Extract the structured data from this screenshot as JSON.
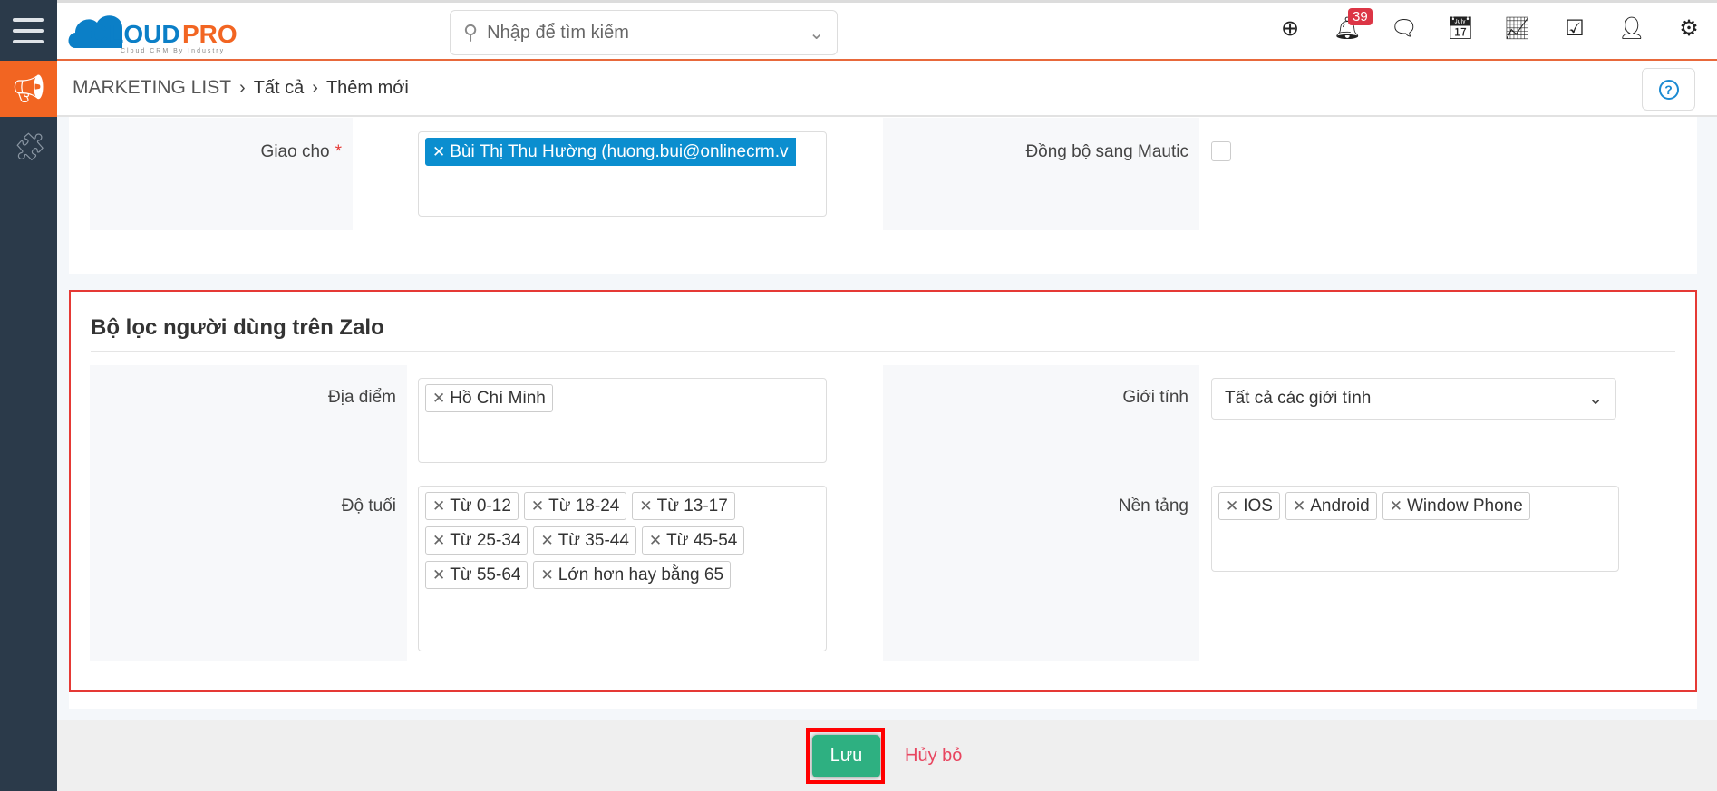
{
  "header": {
    "logo_text": "CLOUDPRO",
    "logo_tagline": "Cloud CRM By Industry",
    "search_placeholder": "Nhập để tìm kiếm",
    "notification_count": "39",
    "icons": [
      "plus-circle-icon",
      "bell-icon",
      "chat-icon",
      "calendar-icon",
      "chart-icon",
      "checkbox-icon",
      "user-icon",
      "gear-icon"
    ]
  },
  "breadcrumb": {
    "module": "MARKETING LIST",
    "items": [
      "Tất cả",
      "Thêm mới"
    ]
  },
  "assign": {
    "label": "Giao cho",
    "required": "*",
    "value": "Bùi Thị Thu Hường (huong.bui@onlinecrm.v",
    "sync_label": "Đồng bộ sang Mautic",
    "sync_checked": false
  },
  "zalo": {
    "title": "Bộ lọc người dùng trên Zalo",
    "location_label": "Địa điểm",
    "locations": [
      "Hồ Chí Minh"
    ],
    "gender_label": "Giới tính",
    "gender_value": "Tất cả các giới tính",
    "age_label": "Độ tuổi",
    "ages": [
      "Từ 0-12",
      "Từ 18-24",
      "Từ 13-17",
      "Từ 25-34",
      "Từ 35-44",
      "Từ 45-54",
      "Từ 55-64",
      "Lớn hơn hay bằng 65"
    ],
    "platform_label": "Nền tảng",
    "platforms": [
      "IOS",
      "Android",
      "Window Phone"
    ]
  },
  "footer": {
    "save": "Lưu",
    "cancel": "Hủy bỏ"
  },
  "colors": {
    "brand_orange": "#f26522",
    "sidebar": "#2b3a4a",
    "save_green": "#2eb081",
    "chip_blue": "#0b8ecf",
    "cancel": "#e8455f"
  }
}
